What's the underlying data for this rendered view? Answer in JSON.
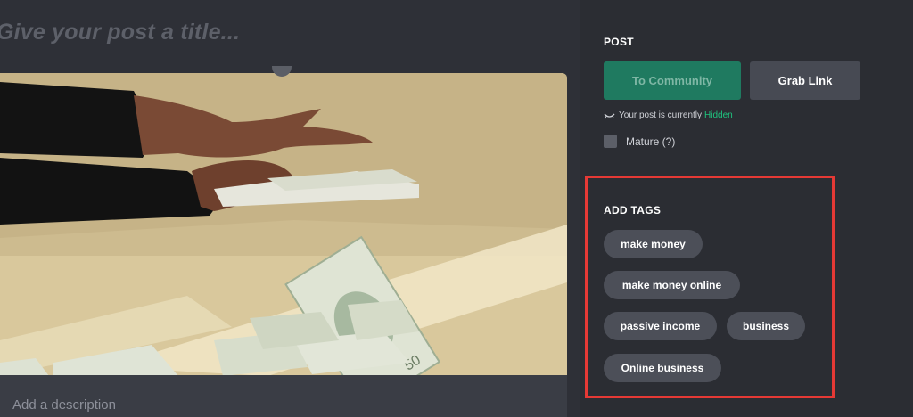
{
  "editor": {
    "title_placeholder": "Give your post a title...",
    "description_placeholder": "Add a description"
  },
  "sidebar": {
    "post_heading": "POST",
    "to_community_label": "To Community",
    "grab_link_label": "Grab Link",
    "status_prefix": "Your post is currently",
    "status_value": "Hidden",
    "mature_label": "Mature (?)",
    "tags_heading": "ADD TAGS",
    "tags": [
      "make money",
      "make money online",
      "passive income",
      "business",
      "Online business"
    ]
  },
  "colors": {
    "accent_green": "#1f7a60",
    "hidden_status": "#1fc47f",
    "highlight_box": "#e53935"
  },
  "icons": [
    "eye-icon"
  ]
}
